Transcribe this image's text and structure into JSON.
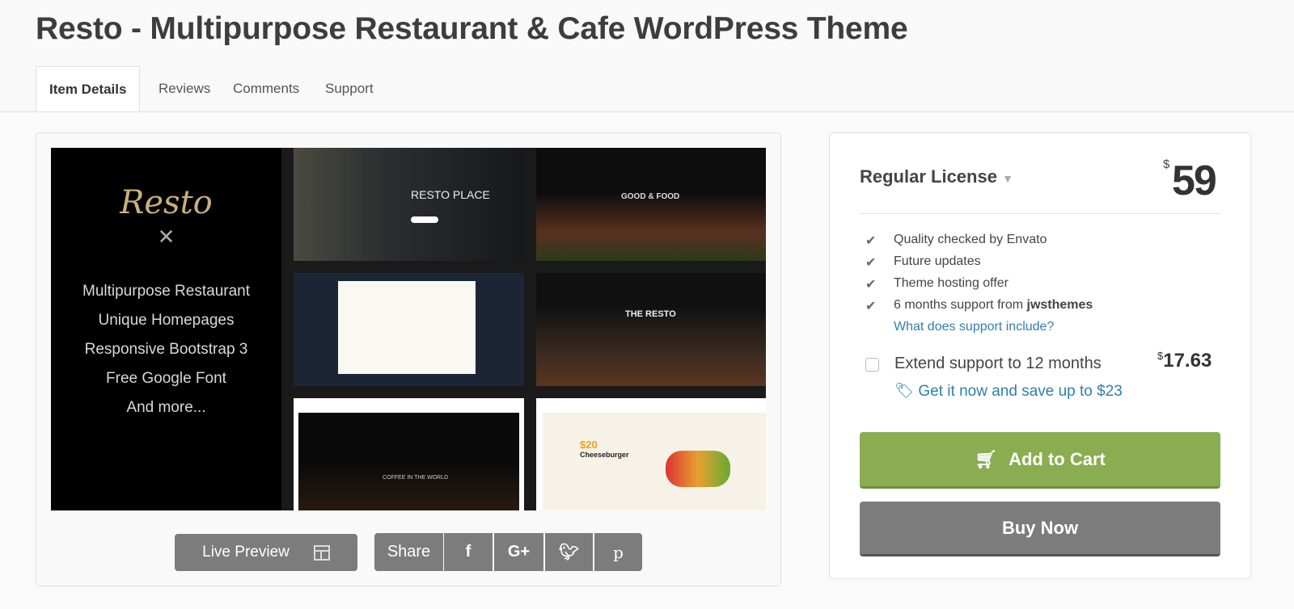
{
  "title": "Resto - Multipurpose Restaurant & Cafe WordPress Theme",
  "tabs": [
    "Item Details",
    "Reviews",
    "Comments",
    "Support"
  ],
  "preview": {
    "logo": "Resto",
    "features": [
      "Multipurpose Restaurant",
      "Unique Homepages",
      "Responsive Bootstrap 3",
      "Free Google Font",
      "And more..."
    ],
    "thumbs": {
      "t1": "RESTO PLACE",
      "t2": "GOOD & FOOD",
      "t4": "THE RESTO",
      "t5": "COFFEE IN THE WORLD",
      "t6_price": "$20",
      "t6_name": "Cheeseburger"
    }
  },
  "actions": {
    "live_preview": "Live Preview",
    "share": "Share",
    "social": [
      "f",
      "G+",
      "twitter",
      "pinterest"
    ]
  },
  "purchase": {
    "license": "Regular License",
    "currency": "$",
    "price": "59",
    "features": [
      "Quality checked by Envato",
      "Future updates",
      "Theme hosting offer"
    ],
    "support_prefix": "6 months support from ",
    "author": "jwsthemes",
    "support_link": "What does support include?",
    "extend_label": "Extend support to 12 months",
    "extend_price": "17.63",
    "extend_checked": false,
    "save_link": "Get it now and save up to $23",
    "add_to_cart": "Add to Cart",
    "buy_now": "Buy Now"
  },
  "colors": {
    "cart": "#8aad51",
    "buy": "#7c7c7c",
    "link": "#2f7fb0"
  }
}
